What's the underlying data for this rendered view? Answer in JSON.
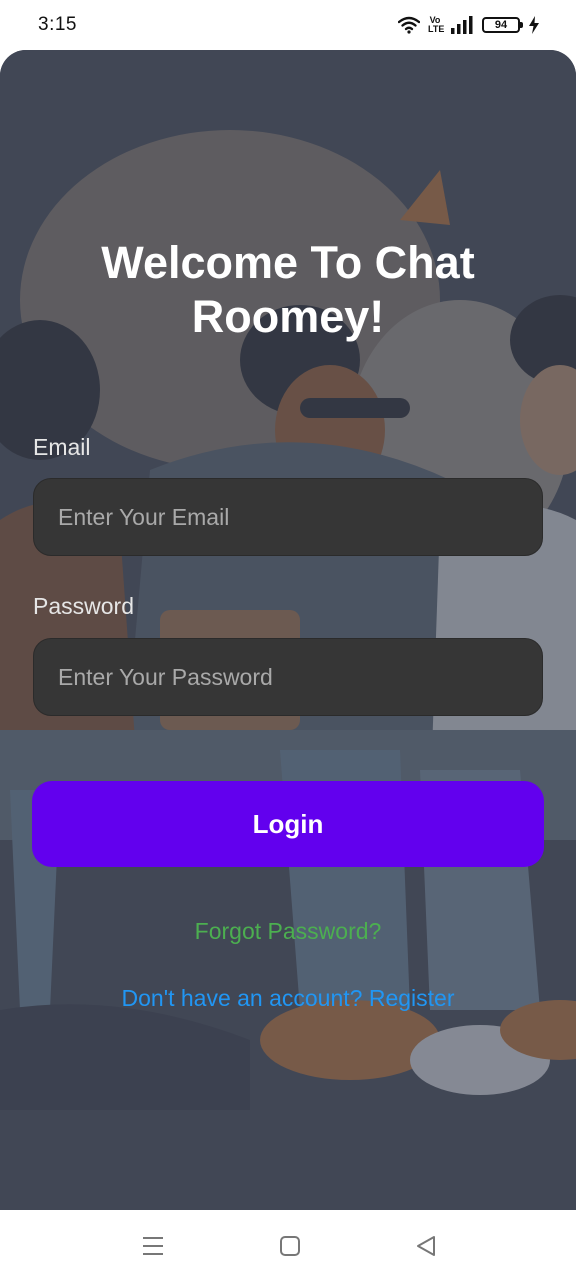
{
  "status_bar": {
    "time": "3:15",
    "volte_line1": "Vo",
    "volte_line2": "LTE",
    "battery": "94",
    "icons": [
      "wifi-icon",
      "volte-icon",
      "signal-icon",
      "battery-icon",
      "charging-icon"
    ]
  },
  "screen": {
    "title": "Welcome To Chat Roomey!",
    "email_label": "Email",
    "email_placeholder": "Enter Your Email",
    "email_value": "",
    "password_label": "Password",
    "password_placeholder": "Enter Your Password",
    "password_value": "",
    "login_label": "Login",
    "forgot_label": "Forgot Password?",
    "register_label": "Don't have an account? Register"
  },
  "colors": {
    "accent": "#6200ee",
    "forgot_link": "#4caf50",
    "register_link": "#2196f3",
    "input_bg": "#363636"
  },
  "nav_bar": {
    "icons": [
      "menu-icon",
      "home-icon",
      "back-icon"
    ]
  }
}
